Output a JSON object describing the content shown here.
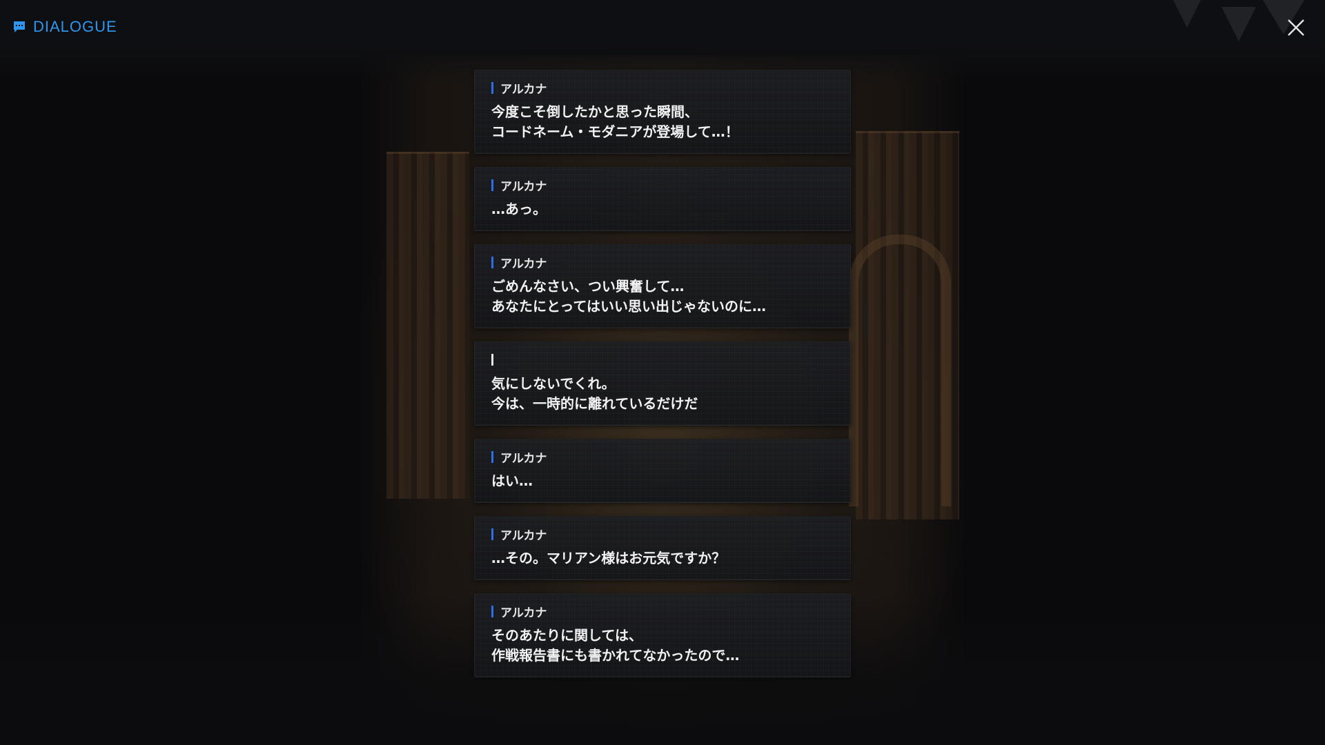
{
  "header": {
    "title": "DIALOGUE",
    "icon": "chat-icon",
    "accent_color": "#2f96ee"
  },
  "close_icon": "close-icon",
  "speaker_bar_color": "#2f6ee6",
  "entries": [
    {
      "speaker": "アルカナ",
      "lines": [
        "今度こそ倒したかと思った瞬間、",
        "コードネーム・モダニアが登場して…！"
      ]
    },
    {
      "speaker": "アルカナ",
      "lines": [
        "…あっ。"
      ]
    },
    {
      "speaker": "アルカナ",
      "lines": [
        "ごめんなさい、つい興奮して…",
        "あなたにとってはいい思い出じゃないのに…"
      ]
    },
    {
      "speaker": "",
      "lines": [
        "気にしないでくれ。",
        "今は、一時的に離れているだけだ"
      ]
    },
    {
      "speaker": "アルカナ",
      "lines": [
        "はい…"
      ]
    },
    {
      "speaker": "アルカナ",
      "lines": [
        "…その。マリアン様はお元気ですか？"
      ]
    },
    {
      "speaker": "アルカナ",
      "lines": [
        "そのあたりに関しては、",
        "作戦報告書にも書かれてなかったので…"
      ]
    }
  ]
}
